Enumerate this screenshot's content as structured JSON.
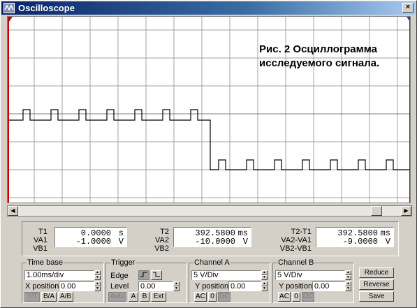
{
  "window": {
    "title": "Oscilloscope",
    "close_glyph": "×"
  },
  "screen": {
    "caption_line1": "Рис. 2 Осциллограмма",
    "caption_line2": "исследуемого сигнала.",
    "cursor_left_color": "#d00000",
    "cursor_right_color": "#3030c0",
    "trace_color": "#000000",
    "grid_color": "#a0a0a0"
  },
  "readouts": {
    "t1": {
      "label_t": "T1",
      "label_va": "VA1",
      "label_vb": "VB1",
      "time": "0.0000",
      "time_unit": "s",
      "va": "-1.0000",
      "va_unit": "V"
    },
    "t2": {
      "label_t": "T2",
      "label_va": "VA2",
      "label_vb": "VB2",
      "time": "392.5800",
      "time_unit": "ms",
      "va": "-10.0000",
      "va_unit": "V"
    },
    "diff": {
      "label_t": "T2-T1",
      "label_va": "VA2-VA1",
      "label_vb": "VB2-VB1",
      "time": "392.5800",
      "time_unit": "ms",
      "va": "-9.0000",
      "va_unit": "V"
    }
  },
  "timebase": {
    "title": "Time base",
    "scale": "1.00ms/div",
    "xpos_label": "X position",
    "xpos": "0.00",
    "btn_yt": "Y/T",
    "btn_ba": "B/A",
    "btn_ab": "A/B"
  },
  "trigger": {
    "title": "Trigger",
    "edge_label": "Edge",
    "level_label": "Level",
    "level": "0.00",
    "btn_auto": "Auto",
    "btn_a": "A",
    "btn_b": "B",
    "btn_ext": "Ext"
  },
  "channel_a": {
    "title": "Channel A",
    "scale": "5 V/Div",
    "ypos_label": "Y position",
    "ypos": "0.00",
    "btn_ac": "AC",
    "btn_0": "0",
    "btn_dc": "DC"
  },
  "channel_b": {
    "title": "Channel B",
    "scale": "5 V/Div",
    "ypos_label": "Y position",
    "ypos": "0.00",
    "btn_ac": "AC",
    "btn_0": "0",
    "btn_dc": "DC"
  },
  "actions": {
    "reduce": "Reduce",
    "reverse": "Reverse",
    "save": "Save"
  }
}
